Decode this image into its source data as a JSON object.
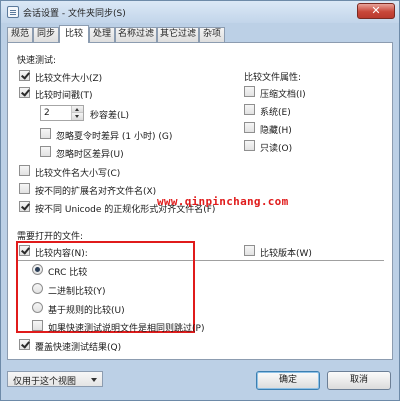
{
  "window": {
    "title": "会话设置 - 文件夹同步(S)",
    "close_glyph": "✕"
  },
  "tabs": [
    {
      "label": "规范",
      "active": false
    },
    {
      "label": "同步",
      "active": false
    },
    {
      "label": "比较",
      "active": true
    },
    {
      "label": "处理",
      "active": false
    },
    {
      "label": "名称过滤",
      "active": false
    },
    {
      "label": "其它过滤",
      "active": false
    },
    {
      "label": "杂项",
      "active": false
    }
  ],
  "quick_test": {
    "heading": "快速测试:",
    "compare_size": {
      "label": "比较文件大小(Z)",
      "checked": true
    },
    "compare_time": {
      "label": "比较时间戳(T)",
      "checked": true
    },
    "tolerance": {
      "value": "2",
      "label": "秒容差(L)"
    },
    "ignore_dst": {
      "label": "忽略夏令时差异 (1 小时) (G)",
      "checked": false
    },
    "ignore_tz": {
      "label": "忽略时区差异(U)",
      "checked": false
    },
    "compare_case": {
      "label": "比较文件名大小写(C)",
      "checked": false
    },
    "align_ext": {
      "label": "按不同的扩展名对齐文件名(X)",
      "checked": false
    },
    "align_unicode": {
      "label": "按不同 Unicode 的正规化形式对齐文件名(F)",
      "checked": true
    }
  },
  "attributes": {
    "heading": "比较文件属性:",
    "compressed": {
      "label": "压缩文档(I)",
      "checked": false
    },
    "system": {
      "label": "系统(E)",
      "checked": false
    },
    "hidden": {
      "label": "隐藏(H)",
      "checked": false
    },
    "readonly": {
      "label": "只读(O)",
      "checked": false
    }
  },
  "open_section": {
    "heading": "需要打开的文件:",
    "compare_content": {
      "label": "比较内容(N):",
      "checked": true
    },
    "crc": {
      "label": "CRC 比较",
      "checked": true
    },
    "binary": {
      "label": "二进制比较(Y)",
      "checked": false
    },
    "rules": {
      "label": "基于规则的比较(U)",
      "checked": false
    },
    "skip_quick": {
      "label": "如果快速测试说明文件是相同则跳过(P)",
      "checked": false
    },
    "compare_version": {
      "label": "比较版本(W)",
      "checked": false
    },
    "override_quick": {
      "label": "覆盖快速测试结果(Q)",
      "checked": true
    }
  },
  "watermark": "www.qinpinchang.com",
  "footer": {
    "view_select": "仅用于这个视图",
    "ok": "确定",
    "cancel": "取消"
  },
  "colors": {
    "highlight": "#e01b1b",
    "window_bg": "#bcd0e6"
  }
}
